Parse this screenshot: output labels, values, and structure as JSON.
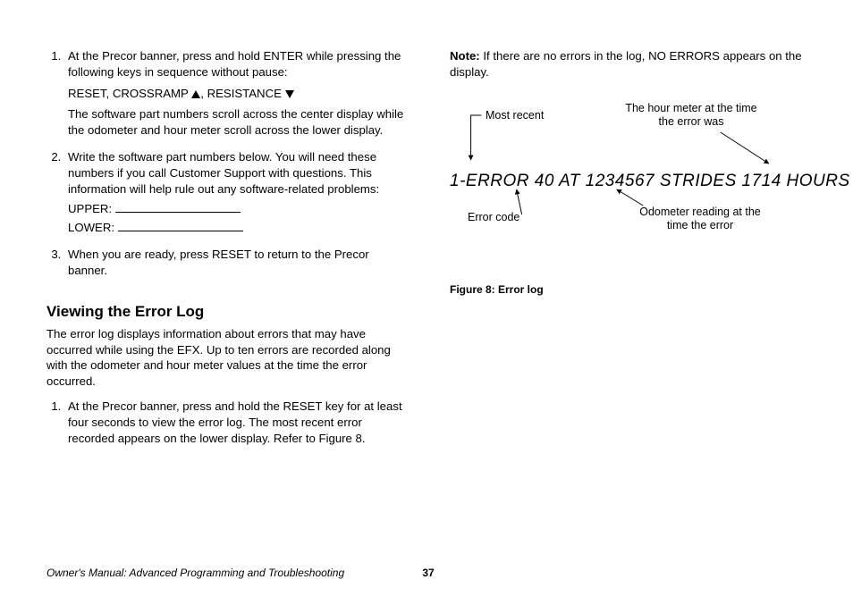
{
  "list1": {
    "item1_a": "At the Precor banner, press and hold ENTER while pressing the following keys in sequence without pause:",
    "item1_keys_a": "RESET, CROSSRAMP ",
    "item1_keys_b": ", RESISTANCE ",
    "item1_b": "The software part numbers scroll across the center display while the odometer and hour meter scroll across the lower display.",
    "item2_a": "Write the software part numbers below. You will need these numbers if you call Customer Support with questions. This information will help rule out any software-related problems:",
    "item2_upper": "UPPER: ",
    "item2_lower": "LOWER: ",
    "item3": "When you are ready, press RESET to return to the Precor banner."
  },
  "section2_heading": "Viewing the Error Log",
  "section2_intro": "The error log displays information about errors that may have occurred while using the EFX. Up to ten errors are recorded along with the odometer and hour meter values at the time the error occurred.",
  "list2": {
    "item1": "At the Precor banner, press and hold the RESET key for at least four seconds to view the error log. The most recent error recorded appears on the lower display. Refer to Figure 8."
  },
  "note_label": "Note:",
  "note_text": " If there are no errors in the log, NO ERRORS appears on the display.",
  "figure": {
    "lcd": "1-ERROR 40 AT 1234567 STRIDES 1714 HOURS",
    "callout_most_recent": "Most recent",
    "callout_hour_meter": "The hour meter at the time the error was",
    "callout_error_code": "Error code",
    "callout_odometer": "Odometer reading at the time the error",
    "caption": "Figure 8: Error log"
  },
  "footer_title": "Owner's Manual: Advanced Programming and Troubleshooting",
  "page_number": "37"
}
